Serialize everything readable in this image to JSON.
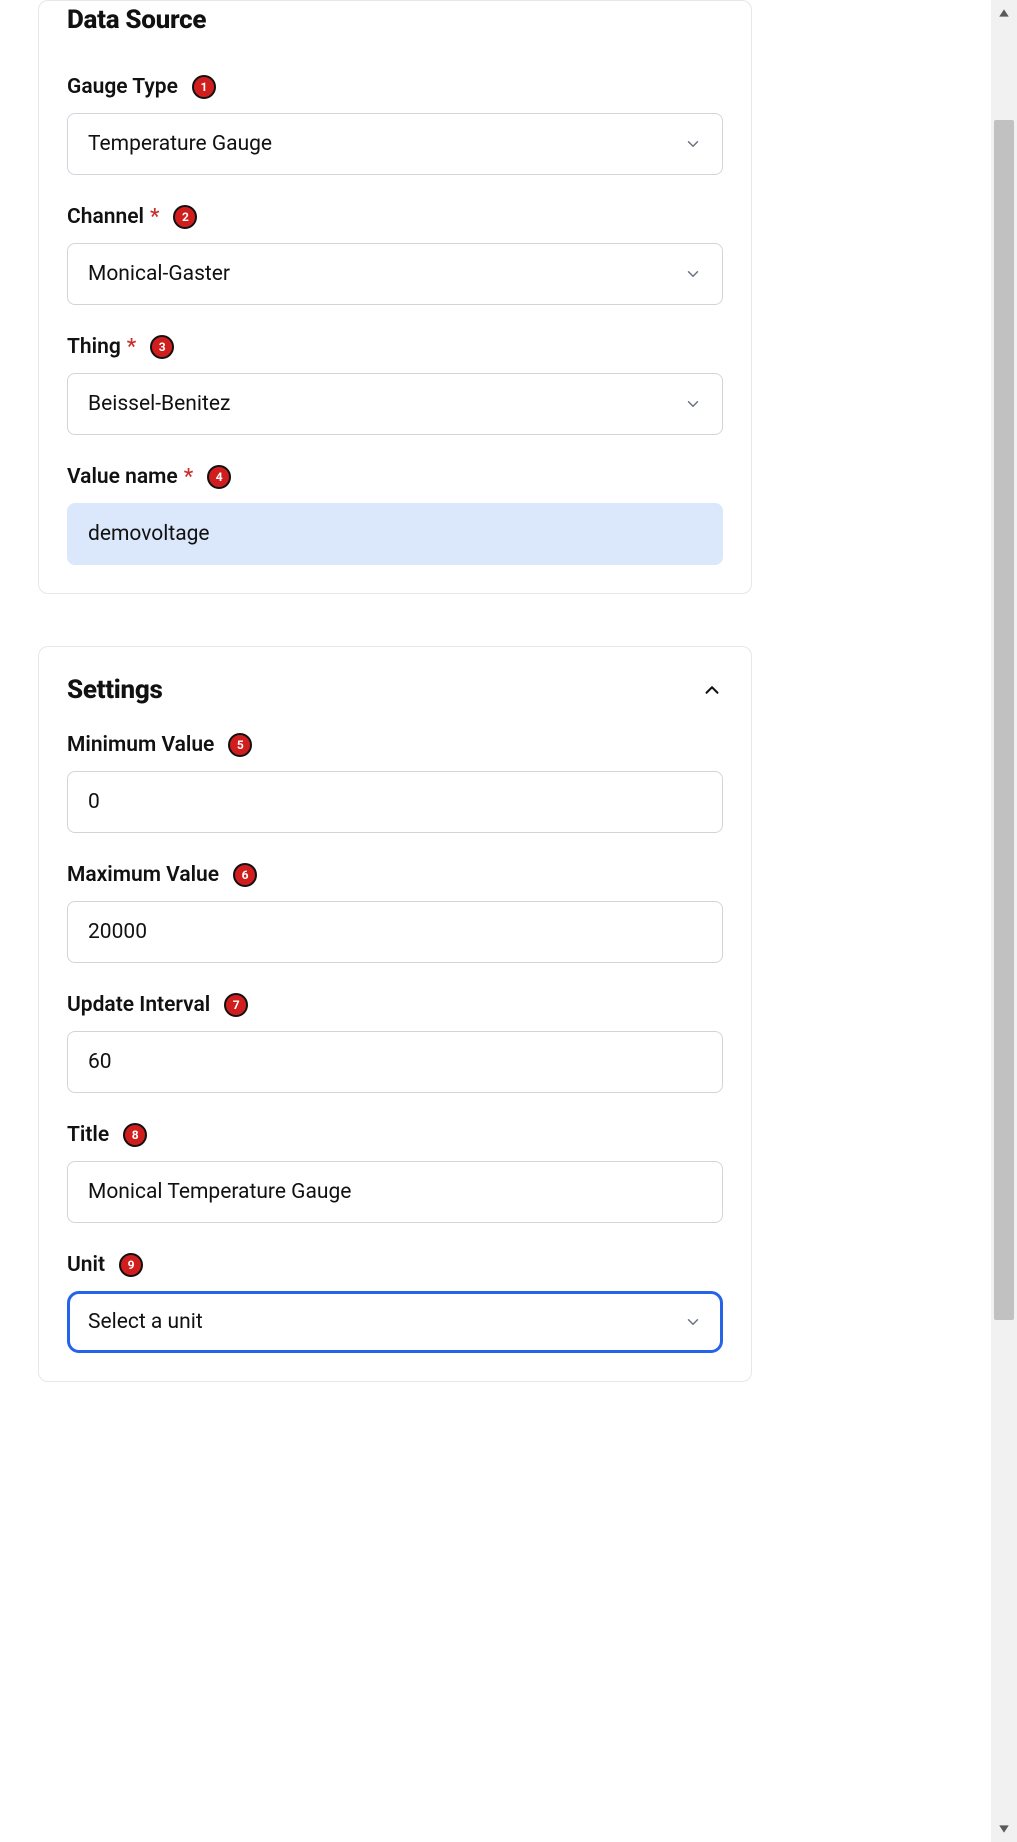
{
  "dataSource": {
    "title": "Data Source",
    "gaugeType": {
      "label": "Gauge Type",
      "value": "Temperature Gauge",
      "badge": "1"
    },
    "channel": {
      "label": "Channel",
      "value": "Monical-Gaster",
      "badge": "2",
      "required": true
    },
    "thing": {
      "label": "Thing",
      "value": "Beissel-Benitez",
      "badge": "3",
      "required": true
    },
    "valueName": {
      "label": "Value name",
      "value": "demovoltage",
      "badge": "4",
      "required": true
    }
  },
  "settings": {
    "title": "Settings",
    "minimumValue": {
      "label": "Minimum Value",
      "value": "0",
      "badge": "5"
    },
    "maximumValue": {
      "label": "Maximum Value",
      "value": "20000",
      "badge": "6"
    },
    "updateInterval": {
      "label": "Update Interval",
      "value": "60",
      "badge": "7"
    },
    "titleField": {
      "label": "Title",
      "value": "Monical Temperature Gauge",
      "badge": "8"
    },
    "unit": {
      "label": "Unit",
      "placeholder": "Select a unit",
      "badge": "9"
    }
  }
}
